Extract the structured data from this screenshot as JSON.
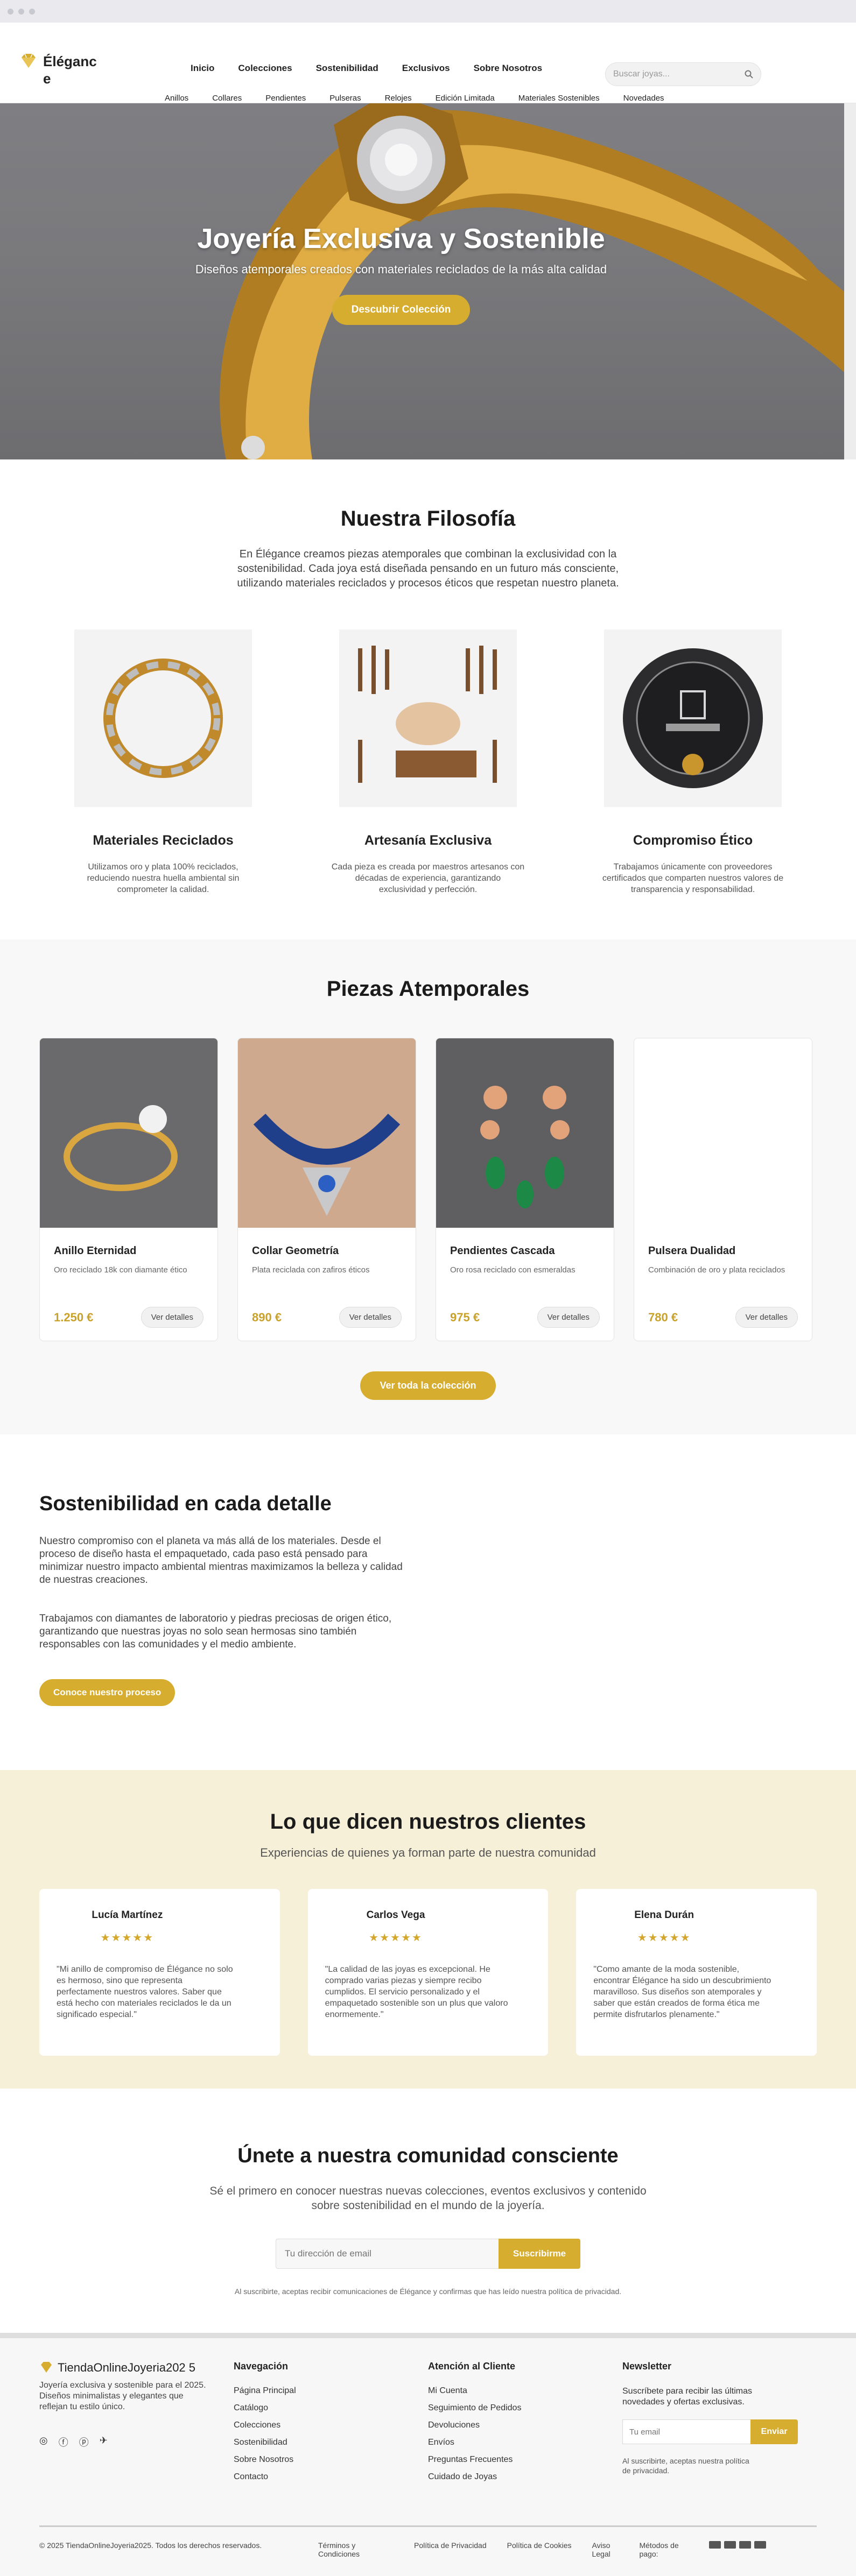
{
  "brand": {
    "name": "Éléganc e",
    "accent": "#d6ad2f"
  },
  "nav": {
    "main": [
      "Inicio",
      "Colecciones",
      "Sostenibilidad",
      "Exclusivos",
      "Sobre Nosotros"
    ],
    "sub": [
      "Anillos",
      "Collares",
      "Pendientes",
      "Pulseras",
      "Relojes",
      "Edición Limitada",
      "Materiales Sostenibles",
      "Novedades"
    ],
    "search_placeholder": "Buscar joyas..."
  },
  "hero": {
    "title": "Joyería Exclusiva y Sostenible",
    "subtitle": "Diseños atemporales creados con materiales reciclados de la más alta calidad",
    "cta": "Descubrir Colección"
  },
  "philosophy": {
    "title": "Nuestra Filosofía",
    "intro": "En Élégance creamos piezas atemporales que combinan la exclusividad con la sostenibilidad. Cada joya está diseñada pensando en un futuro más consciente, utilizando materiales reciclados y procesos éticos que respetan nuestro planeta.",
    "features": [
      {
        "title": "Materiales Reciclados",
        "text": "Utilizamos oro y plata 100% reciclados, reduciendo nuestra huella ambiental sin comprometer la calidad."
      },
      {
        "title": "Artesanía Exclusiva",
        "text": "Cada pieza es creada por maestros artesanos con décadas de experiencia, garantizando exclusividad y perfección."
      },
      {
        "title": "Compromiso Ético",
        "text": "Trabajamos únicamente con proveedores certificados que comparten nuestros valores de transparencia y responsabilidad."
      }
    ]
  },
  "pieces": {
    "title": "Piezas Atemporales",
    "products": [
      {
        "name": "Anillo Eternidad",
        "desc": "Oro reciclado 18k con diamante ético",
        "price": "1.250 €",
        "button": "Ver detalles"
      },
      {
        "name": "Collar Geometría",
        "desc": "Plata reciclada con zafiros éticos",
        "price": "890 €",
        "button": "Ver detalles"
      },
      {
        "name": "Pendientes Cascada",
        "desc": "Oro rosa reciclado con esmeraldas",
        "price": "975 €",
        "button": "Ver detalles"
      },
      {
        "name": "Pulsera Dualidad",
        "desc": "Combinación de oro y plata reciclados",
        "price": "780 €",
        "button": "Ver detalles"
      }
    ],
    "cta": "Ver toda la colección"
  },
  "sustainability": {
    "title": "Sostenibilidad en cada detalle",
    "p1": "Nuestro compromiso con el planeta va más allá de los materiales. Desde el proceso de diseño hasta el empaquetado, cada paso está pensado para minimizar nuestro impacto ambiental mientras maximizamos la belleza y calidad de nuestras creaciones.",
    "p2": "Trabajamos con diamantes de laboratorio y piedras preciosas de origen ético, garantizando que nuestras joyas no solo sean hermosas sino también responsables con las comunidades y el medio ambiente.",
    "cta": "Conoce nuestro proceso"
  },
  "testimonials": {
    "title": "Lo que dicen nuestros clientes",
    "subtitle": "Experiencias de quienes ya forman parte de nuestra comunidad",
    "items": [
      {
        "name": "Lucía Martínez",
        "stars": "★★★★★",
        "quote": "\"Mi anillo de compromiso de Élégance no solo es hermoso, sino que representa perfectamente nuestros valores. Saber que está hecho con materiales reciclados le da un significado especial.\""
      },
      {
        "name": "Carlos Vega",
        "stars": "★★★★★",
        "quote": "\"La calidad de las joyas es excepcional. He comprado varias piezas y siempre recibo cumplidos. El servicio personalizado y el empaquetado sostenible son un plus que valoro enormemente.\""
      },
      {
        "name": "Elena Durán",
        "stars": "★★★★★",
        "quote": "\"Como amante de la moda sostenible, encontrar Élégance ha sido un descubrimiento maravilloso. Sus diseños son atemporales y saber que están creados de forma ética me permite disfrutarlos plenamente.\""
      }
    ]
  },
  "join": {
    "title": "Únete a nuestra comunidad consciente",
    "text": "Sé el primero en conocer nuestras nuevas colecciones, eventos exclusivos y contenido sobre sostenibilidad en el mundo de la joyería.",
    "placeholder": "Tu dirección de email",
    "button": "Suscribirme",
    "fine": "Al suscribirte, aceptas recibir comunicaciones de Élégance y confirmas que has leído nuestra política de privacidad."
  },
  "footer": {
    "brand": "TiendaOnlineJoyeria202 5",
    "desc": "Joyería exclusiva y sostenible para el 2025. Diseños minimalistas y elegantes que reflejan tu estilo único.",
    "nav_title": "Navegación",
    "nav": [
      "Página Principal",
      "Catálogo",
      "Colecciones",
      "Sostenibilidad",
      "Sobre Nosotros",
      "Contacto"
    ],
    "service_title": "Atención al Cliente",
    "service": [
      "Mi Cuenta",
      "Seguimiento de Pedidos",
      "Devoluciones",
      "Envíos",
      "Preguntas Frecuentes",
      "Cuidado de Joyas"
    ],
    "newsletter_title": "Newsletter",
    "newsletter_text": "Suscríbete para recibir las últimas novedades y ofertas exclusivas.",
    "newsletter_placeholder": "Tu email",
    "newsletter_button": "Enviar",
    "newsletter_fine": "Al suscribirte, aceptas nuestra política de privacidad.",
    "copyright": "© 2025 TiendaOnlineJoyeria2025. Todos los derechos reservados.",
    "legal": [
      "Términos y Condiciones",
      "Política de Privacidad",
      "Política de Cookies",
      "Aviso Legal"
    ],
    "payments": "Métodos de pago:"
  }
}
